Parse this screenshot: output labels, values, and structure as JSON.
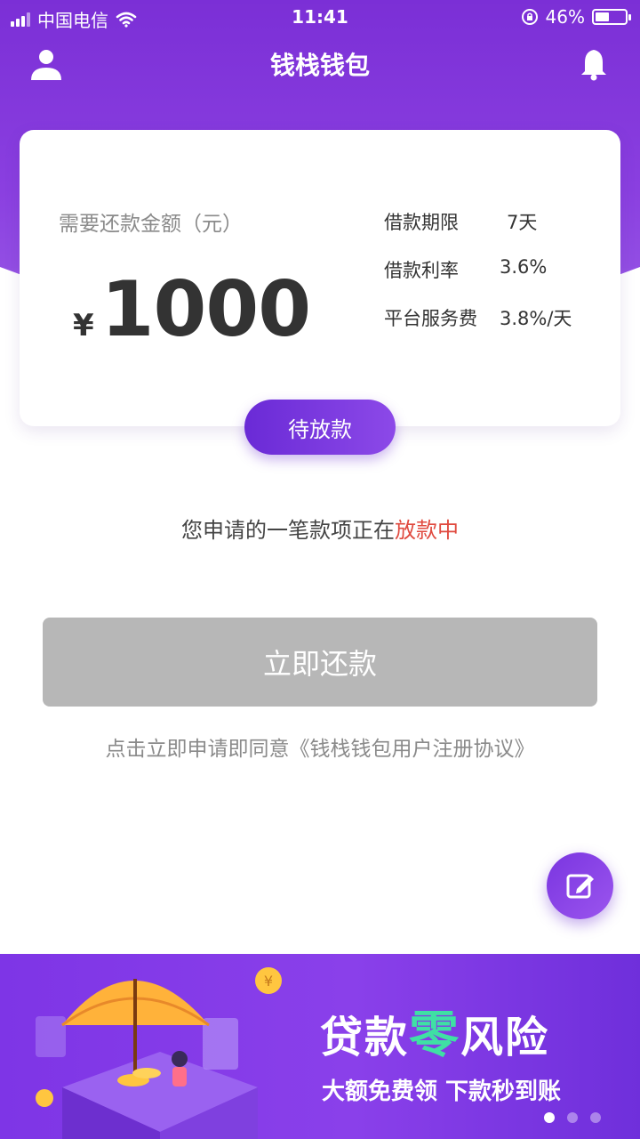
{
  "status_bar": {
    "carrier": "中国电信",
    "time": "11:41",
    "battery": "46%",
    "battery_fraction": 0.46
  },
  "nav": {
    "title": "钱栈钱包",
    "left_icon": "user-icon",
    "right_icon": "bell-icon"
  },
  "card": {
    "amount_label": "需要还款金额（元）",
    "currency": "¥",
    "amount": "1000",
    "info": [
      {
        "key": "借款期限",
        "value": "7天"
      },
      {
        "key": "借款利率",
        "value": "3.6%"
      },
      {
        "key": "平台服务费",
        "value": "3.8%/天"
      }
    ],
    "status": "待放款"
  },
  "notice": {
    "text": "您申请的一笔款项正在",
    "highlight": "放款中"
  },
  "repay_button": "立即还款",
  "agreement": "点击立即申请即同意《钱栈钱包用户注册协议》",
  "fab_icon": "edit-icon",
  "banner": {
    "title_pre": "贷款",
    "title_zero": "零",
    "title_post": "风险",
    "subtitle": "大额免费领 下款秒到账",
    "dots": 3,
    "active_dot": 0
  },
  "colors": {
    "brand": "#7b2fd6",
    "highlight": "#e04a3f",
    "disabled_button": "#b7b7b7",
    "accent_green": "#3fe0a4"
  }
}
